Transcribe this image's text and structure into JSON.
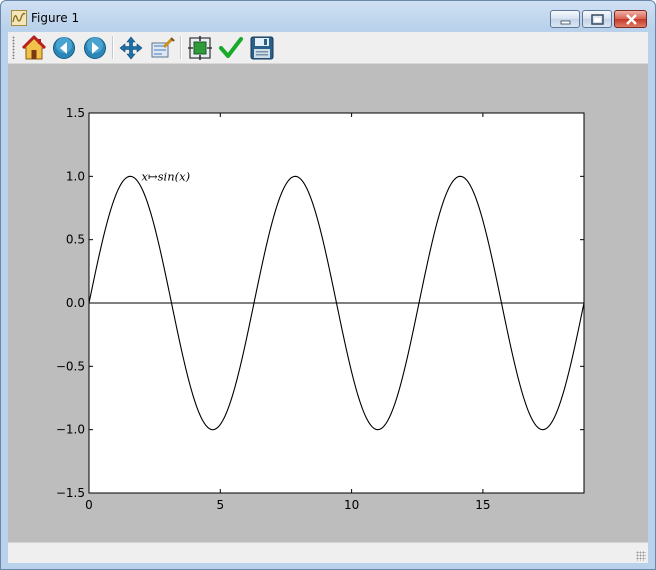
{
  "window": {
    "title": "Figure 1"
  },
  "toolbar": {
    "buttons": [
      {
        "name": "home",
        "icon": "home-icon"
      },
      {
        "name": "back",
        "icon": "back-arrow-icon"
      },
      {
        "name": "forward",
        "icon": "forward-arrow-icon"
      },
      {
        "name": "pan",
        "icon": "move-arrows-icon"
      },
      {
        "name": "zoom",
        "icon": "zoom-rect-icon"
      },
      {
        "name": "subplots",
        "icon": "subplots-icon"
      },
      {
        "name": "edit",
        "icon": "checkmark-icon"
      },
      {
        "name": "save",
        "icon": "floppy-disk-icon"
      }
    ]
  },
  "chart_data": {
    "type": "line",
    "title": "",
    "xlabel": "",
    "ylabel": "",
    "xlim": [
      0,
      18.85
    ],
    "ylim": [
      -1.5,
      1.5
    ],
    "xticks": [
      0,
      5,
      10,
      15
    ],
    "xtick_labels": [
      "0",
      "5",
      "10",
      "15"
    ],
    "yticks": [
      1.5,
      1.0,
      0.5,
      0.0,
      -0.5,
      -1.0,
      -1.5
    ],
    "ytick_labels": [
      "1.5",
      "1.0",
      "0.5",
      "0.0",
      "−0.5",
      "−1.0",
      "−1.5"
    ],
    "grid": false,
    "function": "sin(x)",
    "x_range": [
      0,
      18.85
    ],
    "baseline_y": 0,
    "annotation": {
      "text": "x↦sin(x)",
      "x": 2.0,
      "y": 1.0
    },
    "colors": {
      "line": "#000000",
      "axes_bg": "#ffffff",
      "figure_bg": "#bdbdbd"
    }
  }
}
